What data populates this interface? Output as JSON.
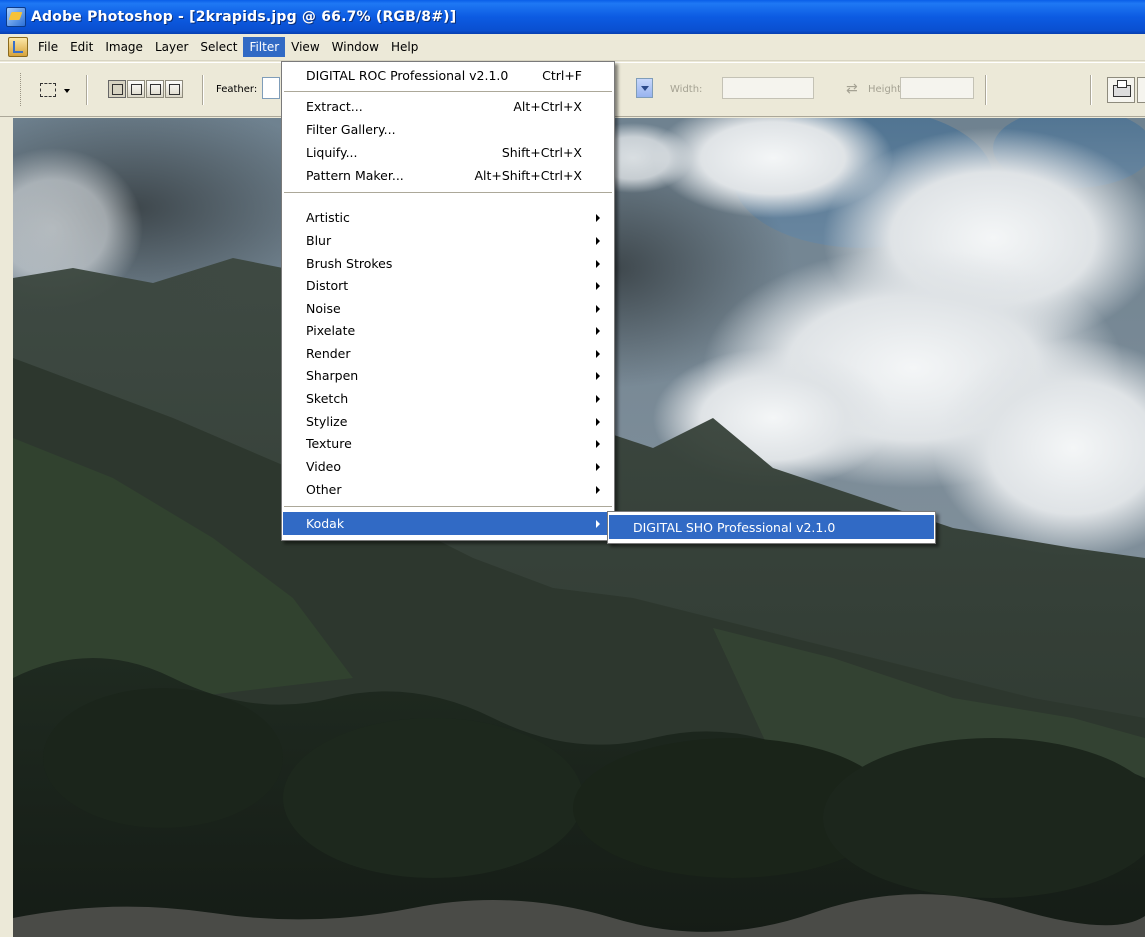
{
  "window": {
    "title": "Adobe Photoshop - [2krapids.jpg @ 66.7% (RGB/8#)]"
  },
  "menubar": {
    "items": [
      "File",
      "Edit",
      "Image",
      "Layer",
      "Select",
      "Filter",
      "View",
      "Window",
      "Help"
    ],
    "active": "Filter"
  },
  "options": {
    "feather_label": "Feather:",
    "width_label": "Width:",
    "height_label": "Height:"
  },
  "filter_menu": {
    "last_filter": {
      "label": "DIGITAL ROC Professional v2.1.0",
      "shortcut": "Ctrl+F"
    },
    "group1": [
      {
        "label": "Extract...",
        "shortcut": "Alt+Ctrl+X"
      },
      {
        "label": "Filter Gallery...",
        "shortcut": ""
      },
      {
        "label": "Liquify...",
        "shortcut": "Shift+Ctrl+X"
      },
      {
        "label": "Pattern Maker...",
        "shortcut": "Alt+Shift+Ctrl+X"
      }
    ],
    "submenus": [
      "Artistic",
      "Blur",
      "Brush Strokes",
      "Distort",
      "Noise",
      "Pixelate",
      "Render",
      "Sharpen",
      "Sketch",
      "Stylize",
      "Texture",
      "Video",
      "Other"
    ],
    "kodak": "Kodak"
  },
  "kodak_submenu": {
    "items": [
      "DIGITAL SHO Professional v2.1.0"
    ]
  },
  "colors": {
    "title_bar": "#0a5ee8",
    "menu_highlight": "#316ac5",
    "chrome": "#ece9d8"
  },
  "icons": [
    "photoshop-app-icon",
    "document-menu-icon",
    "rect-marquee-icon",
    "swap-icon",
    "printer-icon",
    "submenu-arrow-icon"
  ]
}
